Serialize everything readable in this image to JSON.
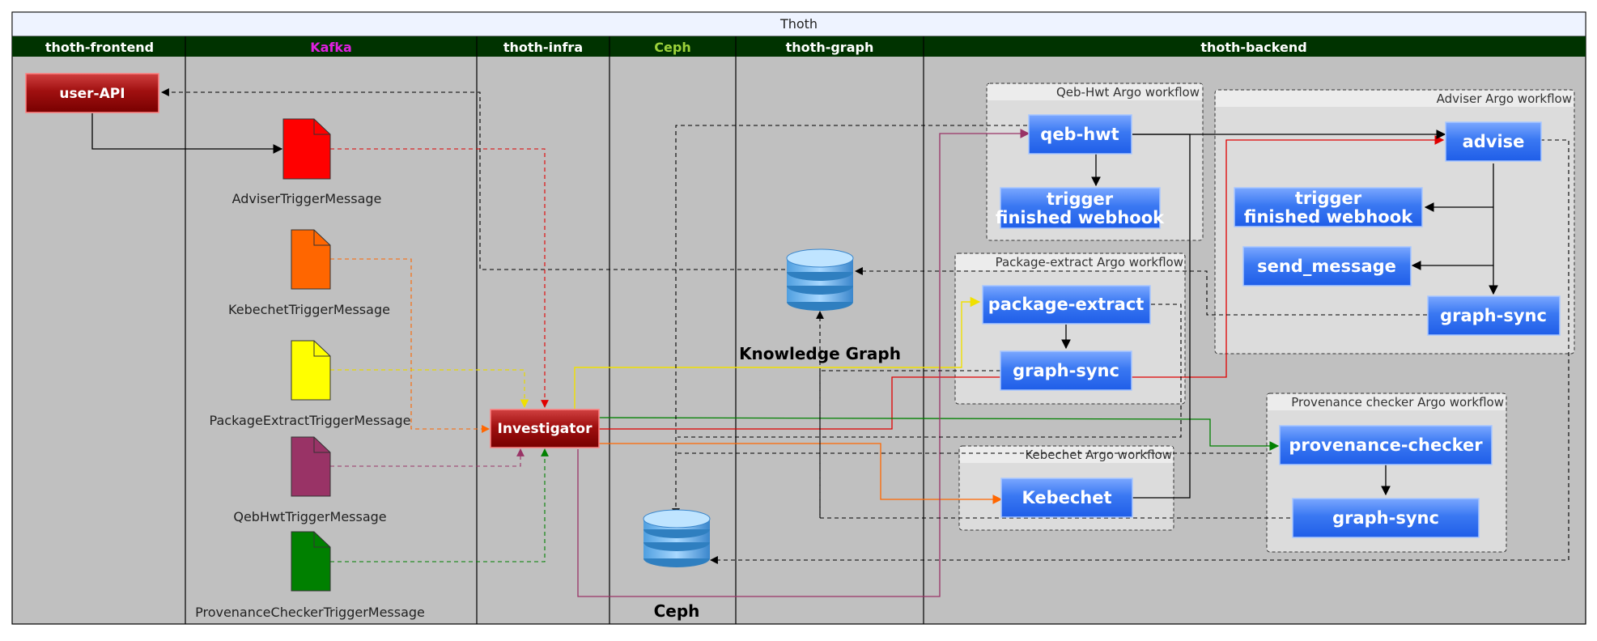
{
  "title": "Thoth",
  "lanes": [
    {
      "label": "thoth-frontend",
      "color": "#ffffff"
    },
    {
      "label": "Kafka",
      "color": "#e020e0"
    },
    {
      "label": "thoth-infra",
      "color": "#ffffff"
    },
    {
      "label": "Ceph",
      "color": "#9cd23a"
    },
    {
      "label": "thoth-graph",
      "color": "#ffffff"
    },
    {
      "label": "thoth-backend",
      "color": "#ffffff"
    }
  ],
  "nodes": {
    "user_api": "user-API",
    "investigator": "Investigator",
    "knowledge_graph": "Knowledge Graph",
    "ceph": "Ceph"
  },
  "messages": [
    {
      "label": "AdviserTriggerMessage",
      "color": "#ff0000"
    },
    {
      "label": "KebechetTriggerMessage",
      "color": "#ff6600"
    },
    {
      "label": "PackageExtractTriggerMessage",
      "color": "#ffff00"
    },
    {
      "label": "QebHwtTriggerMessage",
      "color": "#993366"
    },
    {
      "label": "ProvenanceCheckerTriggerMessage",
      "color": "#008000"
    }
  ],
  "workflows": {
    "qeb": {
      "title": "Qeb-Hwt Argo workflow",
      "main": "qeb-hwt",
      "trigger_l1": "trigger",
      "trigger_l2": "finished webhook"
    },
    "adviser": {
      "title": "Adviser Argo workflow",
      "main": "advise",
      "trigger_l1": "trigger",
      "trigger_l2": "finished webhook",
      "send": "send_message",
      "sync": "graph-sync"
    },
    "pkg": {
      "title": "Package-extract Argo workflow",
      "main": "package-extract",
      "sync": "graph-sync"
    },
    "keb": {
      "title": "Kebechet Argo workflow",
      "main": "Kebechet"
    },
    "prov": {
      "title": "Provenance checker Argo workflow",
      "main": "provenance-checker",
      "sync": "graph-sync"
    }
  }
}
